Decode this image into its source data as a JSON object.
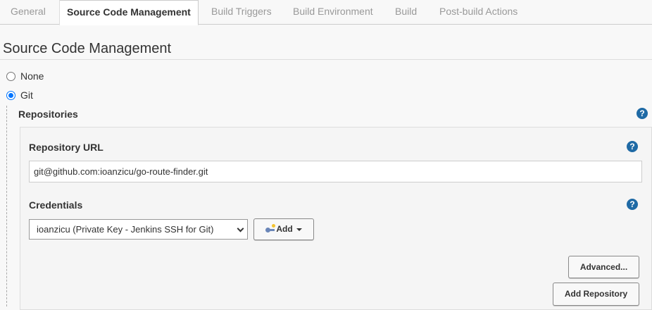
{
  "tabs": [
    {
      "label": "General"
    },
    {
      "label": "Source Code Management"
    },
    {
      "label": "Build Triggers"
    },
    {
      "label": "Build Environment"
    },
    {
      "label": "Build"
    },
    {
      "label": "Post-build Actions"
    }
  ],
  "section": {
    "title": "Source Code Management"
  },
  "scm_options": [
    {
      "label": "None",
      "selected": false
    },
    {
      "label": "Git",
      "selected": true
    }
  ],
  "repositories": {
    "label": "Repositories",
    "help": "?",
    "url_label": "Repository URL",
    "url_help": "?",
    "url_value": "git@github.com:ioanzicu/go-route-finder.git",
    "credentials_label": "Credentials",
    "credentials_help": "?",
    "credentials_selected": "ioanzicu (Private Key - Jenkins SSH for Git)",
    "add_label": "Add",
    "advanced_label": "Advanced...",
    "add_repository_label": "Add Repository"
  },
  "colors": {
    "help_icon": "#1f6aa5",
    "radio_selected": "#0075ff"
  }
}
